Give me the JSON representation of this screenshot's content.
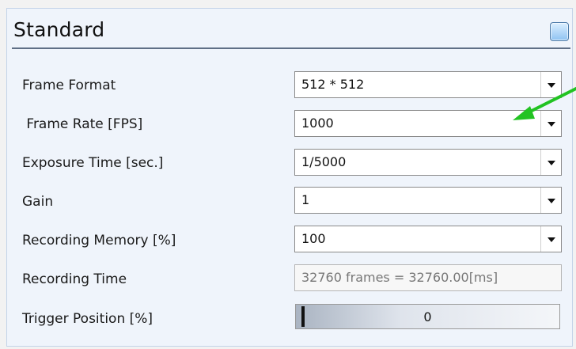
{
  "panel": {
    "title": "Standard"
  },
  "rows": [
    {
      "label": "Frame Format",
      "value": "512 * 512"
    },
    {
      "label": " Frame Rate [FPS]",
      "value": "1000"
    },
    {
      "label": "Exposure Time [sec.]",
      "value": "1/5000"
    },
    {
      "label": "Gain",
      "value": "1"
    },
    {
      "label": "Recording Memory [%]",
      "value": "100"
    },
    {
      "label": "Recording Time",
      "value": "32760 frames = 32760.00[ms]"
    },
    {
      "label": "Trigger Position [%]",
      "value": "0"
    }
  ],
  "trigger_position": {
    "level": 0.0
  },
  "colors": {
    "panel_bg": "#eff4fb",
    "header_line": "#5f6f86",
    "annotation_arrow": "#22c322"
  },
  "icons": {
    "panel_toggle": "toggle-square-icon",
    "dropdown": "chevron-down-icon",
    "annotation": "green-arrow-icon"
  }
}
